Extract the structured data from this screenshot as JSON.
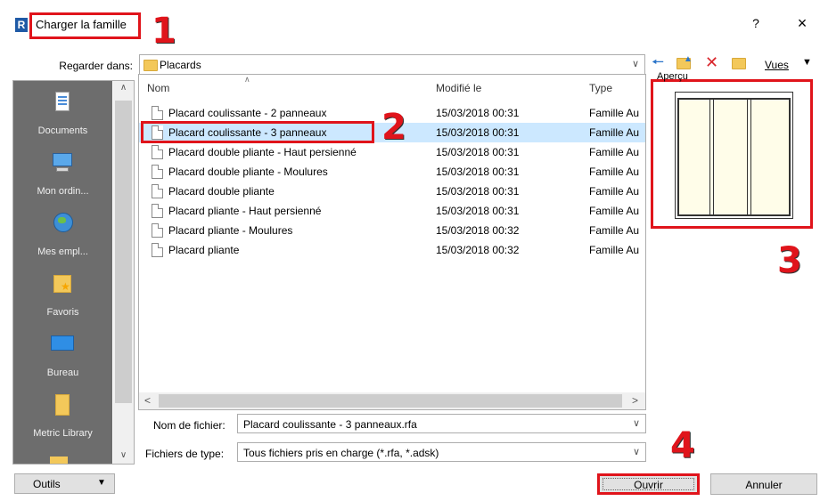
{
  "window": {
    "app_icon_letter": "R",
    "title": "Charger la famille",
    "help": "?",
    "close": "×"
  },
  "annotations": [
    "1",
    "2",
    "3",
    "4"
  ],
  "look_in": {
    "label": "Regarder dans:",
    "value": "Placards"
  },
  "toolbar": {
    "views_label": "Vues"
  },
  "places": [
    {
      "label": "Documents",
      "icon": "documents-icon"
    },
    {
      "label": "Mon ordin...",
      "icon": "computer-icon"
    },
    {
      "label": "Mes empl...",
      "icon": "network-globe-icon"
    },
    {
      "label": "Favoris",
      "icon": "favorites-folder-icon"
    },
    {
      "label": "Bureau",
      "icon": "desktop-icon"
    },
    {
      "label": "Metric Library",
      "icon": "folder-icon"
    }
  ],
  "columns": {
    "name": "Nom",
    "modified": "Modifié le",
    "type": "Type"
  },
  "files": [
    {
      "name": "Placard coulissante - 2 panneaux",
      "modified": "15/03/2018 00:31",
      "type": "Famille Au"
    },
    {
      "name": "Placard coulissante - 3 panneaux",
      "modified": "15/03/2018 00:31",
      "type": "Famille Au"
    },
    {
      "name": "Placard double pliante - Haut persienné",
      "modified": "15/03/2018 00:31",
      "type": "Famille Au"
    },
    {
      "name": "Placard double pliante - Moulures",
      "modified": "15/03/2018 00:31",
      "type": "Famille Au"
    },
    {
      "name": "Placard double pliante",
      "modified": "15/03/2018 00:31",
      "type": "Famille Au"
    },
    {
      "name": "Placard pliante - Haut persienné",
      "modified": "15/03/2018 00:31",
      "type": "Famille Au"
    },
    {
      "name": "Placard pliante - Moulures",
      "modified": "15/03/2018 00:32",
      "type": "Famille Au"
    },
    {
      "name": "Placard pliante",
      "modified": "15/03/2018 00:32",
      "type": "Famille Au"
    }
  ],
  "selected_file_index": 1,
  "preview": {
    "label": "Aperçu"
  },
  "filename": {
    "label": "Nom de fichier:",
    "value": "Placard coulissante - 3 panneaux.rfa"
  },
  "filetype": {
    "label": "Fichiers de type:",
    "value": "Tous fichiers pris en charge  (*.rfa, *.adsk)"
  },
  "buttons": {
    "tools": "Outils",
    "open": "Ouvrir",
    "cancel": "Annuler"
  },
  "colors": {
    "annotation_red": "#e0141b",
    "selection_blue": "#cce8ff",
    "places_bg": "#6d6d6d"
  }
}
